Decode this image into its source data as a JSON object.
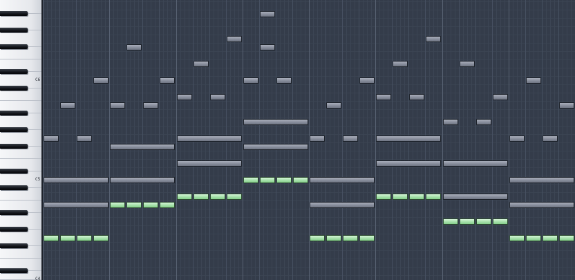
{
  "editor": {
    "keyboard_labels": [
      {
        "key": "c6",
        "text": "C6",
        "row": 9
      },
      {
        "key": "c5",
        "text": "C5",
        "row": 21
      },
      {
        "key": "c4",
        "text": "C4",
        "row": 33
      }
    ],
    "top_midi_note": 95,
    "visible_rows": 34,
    "beats_per_bar": 4,
    "steps_per_beat": 4,
    "visible_bars": 8,
    "colors": {
      "grid_bg": "#343c4a",
      "bar_line": "#586273",
      "beat_line": "#465061",
      "step_line": "#3c4554",
      "row_line": "#3a4351",
      "grey_note": "#8a909e",
      "green_note": "#a9e2ad"
    },
    "notes": [
      {
        "kind": "grey",
        "row": 16,
        "start": 0,
        "length": 1
      },
      {
        "kind": "grey",
        "row": 16,
        "start": 2,
        "length": 1
      },
      {
        "kind": "grey",
        "row": 12,
        "start": 1,
        "length": 1
      },
      {
        "kind": "grey",
        "row": 9,
        "start": 3,
        "length": 1
      },
      {
        "kind": "grey",
        "row": 21,
        "start": 0,
        "length": 4
      },
      {
        "kind": "grey",
        "row": 24,
        "start": 0,
        "length": 4
      },
      {
        "kind": "green",
        "row": 28,
        "start": 0,
        "length": 1
      },
      {
        "kind": "green",
        "row": 28,
        "start": 1,
        "length": 1
      },
      {
        "kind": "green",
        "row": 28,
        "start": 2,
        "length": 1
      },
      {
        "kind": "green",
        "row": 28,
        "start": 3,
        "length": 1
      },
      {
        "kind": "grey",
        "row": 5,
        "start": 5,
        "length": 1
      },
      {
        "kind": "grey",
        "row": 12,
        "start": 4,
        "length": 1
      },
      {
        "kind": "grey",
        "row": 12,
        "start": 6,
        "length": 1
      },
      {
        "kind": "grey",
        "row": 9,
        "start": 7,
        "length": 1
      },
      {
        "kind": "grey",
        "row": 17,
        "start": 4,
        "length": 4
      },
      {
        "kind": "grey",
        "row": 21,
        "start": 4,
        "length": 4
      },
      {
        "kind": "green",
        "row": 24,
        "start": 4,
        "length": 1
      },
      {
        "kind": "green",
        "row": 24,
        "start": 5,
        "length": 1
      },
      {
        "kind": "green",
        "row": 24,
        "start": 6,
        "length": 1
      },
      {
        "kind": "green",
        "row": 24,
        "start": 7,
        "length": 1
      },
      {
        "kind": "grey",
        "row": 11,
        "start": 8,
        "length": 1
      },
      {
        "kind": "grey",
        "row": 11,
        "start": 10,
        "length": 1
      },
      {
        "kind": "grey",
        "row": 7,
        "start": 9,
        "length": 1
      },
      {
        "kind": "grey",
        "row": 4,
        "start": 11,
        "length": 1
      },
      {
        "kind": "grey",
        "row": 16,
        "start": 8,
        "length": 4
      },
      {
        "kind": "grey",
        "row": 19,
        "start": 8,
        "length": 4
      },
      {
        "kind": "green",
        "row": 23,
        "start": 8,
        "length": 1
      },
      {
        "kind": "green",
        "row": 23,
        "start": 9,
        "length": 1
      },
      {
        "kind": "green",
        "row": 23,
        "start": 10,
        "length": 1
      },
      {
        "kind": "green",
        "row": 23,
        "start": 11,
        "length": 1
      },
      {
        "kind": "grey",
        "row": 9,
        "start": 12,
        "length": 1
      },
      {
        "kind": "grey",
        "row": 9,
        "start": 14,
        "length": 1
      },
      {
        "kind": "grey",
        "row": 5,
        "start": 13,
        "length": 1
      },
      {
        "kind": "grey",
        "row": 1,
        "start": 13,
        "length": 1
      },
      {
        "kind": "grey",
        "row": 14,
        "start": 12,
        "length": 4
      },
      {
        "kind": "grey",
        "row": 17,
        "start": 12,
        "length": 4
      },
      {
        "kind": "green",
        "row": 21,
        "start": 12,
        "length": 1
      },
      {
        "kind": "green",
        "row": 21,
        "start": 13,
        "length": 1
      },
      {
        "kind": "green",
        "row": 21,
        "start": 14,
        "length": 1
      },
      {
        "kind": "green",
        "row": 21,
        "start": 15,
        "length": 1
      },
      {
        "kind": "grey",
        "row": 16,
        "start": 16,
        "length": 1
      },
      {
        "kind": "grey",
        "row": 16,
        "start": 18,
        "length": 1
      },
      {
        "kind": "grey",
        "row": 12,
        "start": 17,
        "length": 1
      },
      {
        "kind": "grey",
        "row": 9,
        "start": 19,
        "length": 1
      },
      {
        "kind": "grey",
        "row": 21,
        "start": 16,
        "length": 4
      },
      {
        "kind": "grey",
        "row": 24,
        "start": 16,
        "length": 4
      },
      {
        "kind": "green",
        "row": 28,
        "start": 16,
        "length": 1
      },
      {
        "kind": "green",
        "row": 28,
        "start": 17,
        "length": 1
      },
      {
        "kind": "green",
        "row": 28,
        "start": 18,
        "length": 1
      },
      {
        "kind": "green",
        "row": 28,
        "start": 19,
        "length": 1
      },
      {
        "kind": "grey",
        "row": 11,
        "start": 20,
        "length": 1
      },
      {
        "kind": "grey",
        "row": 11,
        "start": 22,
        "length": 1
      },
      {
        "kind": "grey",
        "row": 7,
        "start": 21,
        "length": 1
      },
      {
        "kind": "grey",
        "row": 4,
        "start": 23,
        "length": 1
      },
      {
        "kind": "grey",
        "row": 16,
        "start": 20,
        "length": 4
      },
      {
        "kind": "grey",
        "row": 19,
        "start": 20,
        "length": 4
      },
      {
        "kind": "green",
        "row": 23,
        "start": 20,
        "length": 1
      },
      {
        "kind": "green",
        "row": 23,
        "start": 21,
        "length": 1
      },
      {
        "kind": "green",
        "row": 23,
        "start": 22,
        "length": 1
      },
      {
        "kind": "green",
        "row": 23,
        "start": 23,
        "length": 1
      },
      {
        "kind": "grey",
        "row": 14,
        "start": 24,
        "length": 1
      },
      {
        "kind": "grey",
        "row": 14,
        "start": 26,
        "length": 1
      },
      {
        "kind": "grey",
        "row": 7,
        "start": 25,
        "length": 1
      },
      {
        "kind": "grey",
        "row": 11,
        "start": 27,
        "length": 1
      },
      {
        "kind": "grey",
        "row": 19,
        "start": 24,
        "length": 4
      },
      {
        "kind": "grey",
        "row": 23,
        "start": 24,
        "length": 4
      },
      {
        "kind": "green",
        "row": 26,
        "start": 24,
        "length": 1
      },
      {
        "kind": "green",
        "row": 26,
        "start": 25,
        "length": 1
      },
      {
        "kind": "green",
        "row": 26,
        "start": 26,
        "length": 1
      },
      {
        "kind": "green",
        "row": 26,
        "start": 27,
        "length": 1
      },
      {
        "kind": "grey",
        "row": 16,
        "start": 28,
        "length": 1
      },
      {
        "kind": "grey",
        "row": 16,
        "start": 30,
        "length": 1
      },
      {
        "kind": "grey",
        "row": 9,
        "start": 29,
        "length": 1
      },
      {
        "kind": "grey",
        "row": 12,
        "start": 31,
        "length": 1
      },
      {
        "kind": "grey",
        "row": 21,
        "start": 28,
        "length": 4
      },
      {
        "kind": "grey",
        "row": 24,
        "start": 28,
        "length": 4
      },
      {
        "kind": "green",
        "row": 28,
        "start": 28,
        "length": 1
      },
      {
        "kind": "green",
        "row": 28,
        "start": 29,
        "length": 1
      },
      {
        "kind": "green",
        "row": 28,
        "start": 30,
        "length": 1
      },
      {
        "kind": "green",
        "row": 28,
        "start": 31,
        "length": 1
      }
    ]
  }
}
